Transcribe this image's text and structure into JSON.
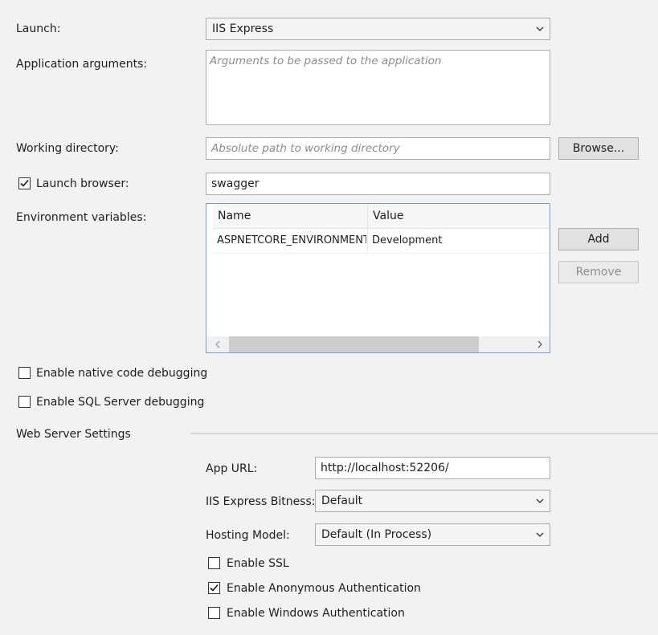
{
  "launch": {
    "label": "Launch:",
    "value": "IIS Express"
  },
  "app_args": {
    "label": "Application arguments:",
    "placeholder": "Arguments to be passed to the application"
  },
  "working_dir": {
    "label": "Working directory:",
    "placeholder": "Absolute path to working directory",
    "browse_label": "Browse..."
  },
  "launch_browser": {
    "label": "Launch browser:",
    "checked": true,
    "value": "swagger"
  },
  "env_vars": {
    "label": "Environment variables:",
    "columns": [
      "Name",
      "Value"
    ],
    "rows": [
      {
        "name": "ASPNETCORE_ENVIRONMENT",
        "value": "Development"
      }
    ],
    "add_label": "Add",
    "remove_label": "Remove"
  },
  "native_debug": {
    "label": "Enable native code debugging",
    "checked": false
  },
  "sql_debug": {
    "label": "Enable SQL Server debugging",
    "checked": false
  },
  "web_server": {
    "section_title": "Web Server Settings",
    "app_url_label": "App URL:",
    "app_url_value": "http://localhost:52206/",
    "bitness_label": "IIS Express Bitness:",
    "bitness_value": "Default",
    "hosting_label": "Hosting Model:",
    "hosting_value": "Default (In Process)",
    "ssl_label": "Enable SSL",
    "ssl_checked": false,
    "anon_label": "Enable Anonymous Authentication",
    "anon_checked": true,
    "windows_label": "Enable Windows Authentication",
    "windows_checked": false
  }
}
